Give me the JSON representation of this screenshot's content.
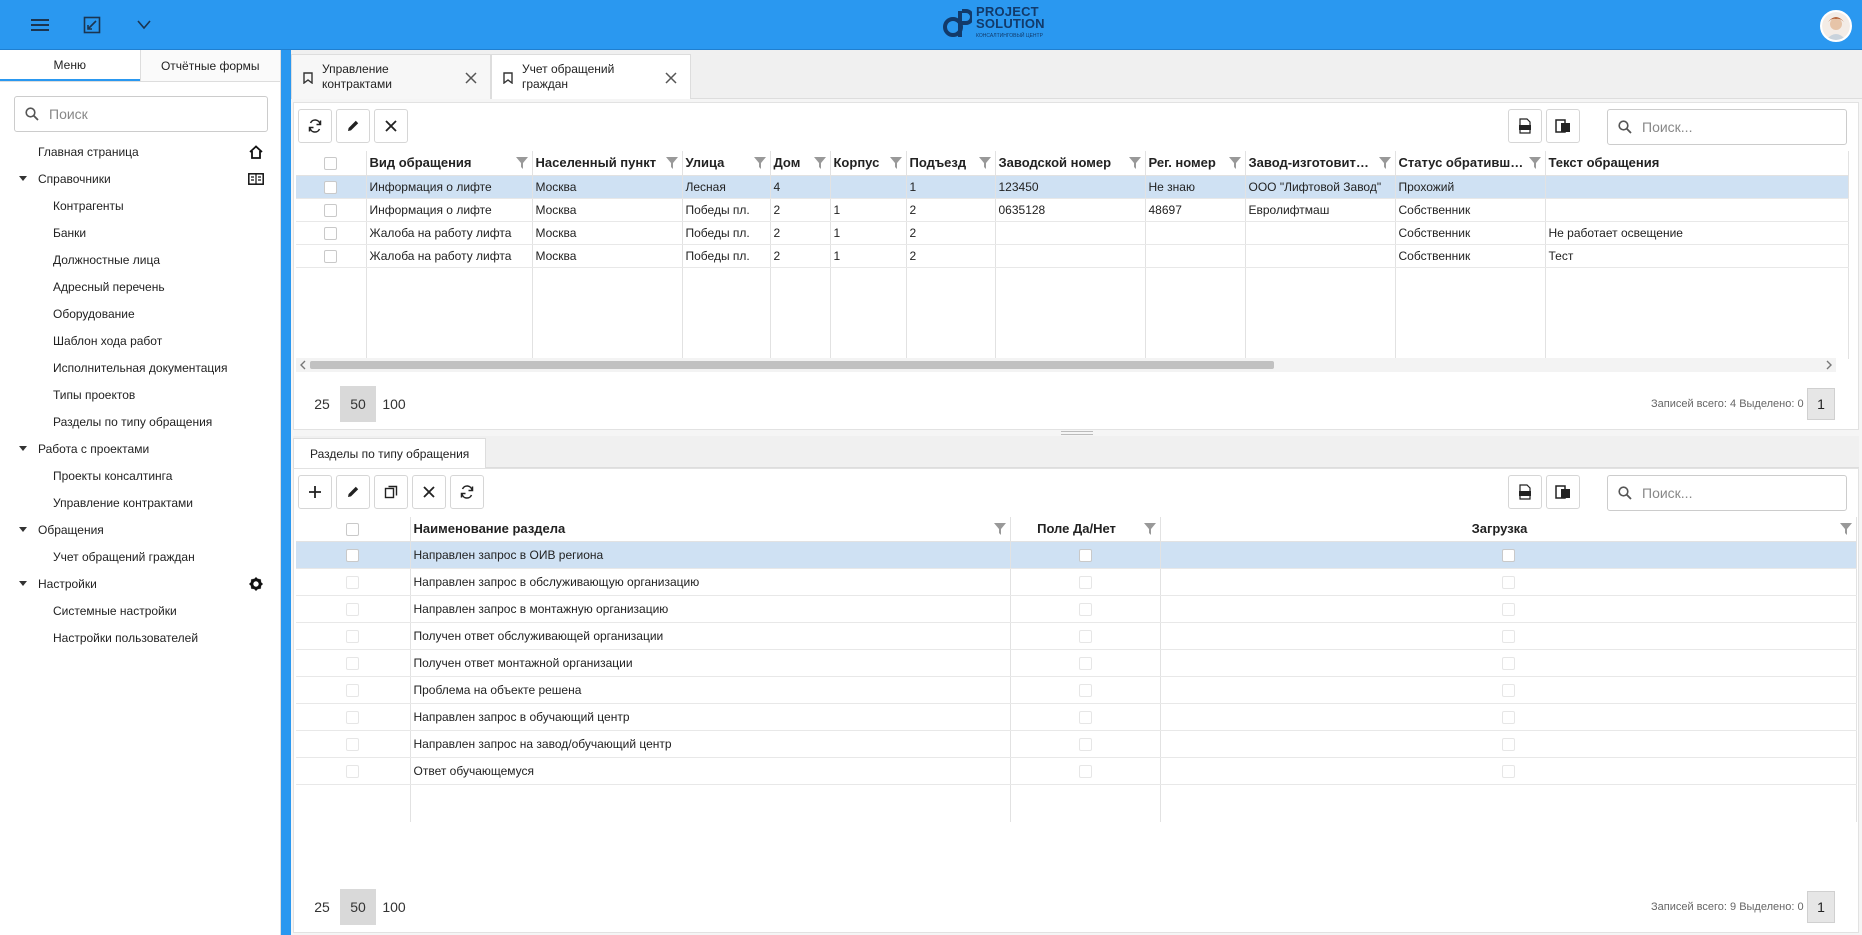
{
  "app": {
    "logo_line1": "PROJECT",
    "logo_line2": "SOLUTION",
    "logo_tagline": "КОНСАЛТИНГОВЫЙ ЦЕНТР"
  },
  "colors": {
    "accent": "#2a98f0",
    "selected_row": "#cfe1f3"
  },
  "sidebar": {
    "tabs": [
      "Меню",
      "Отчётные формы"
    ],
    "search_placeholder": "Поиск",
    "items": [
      {
        "label": "Главная страница",
        "level": 0,
        "icon": "home-icon"
      },
      {
        "label": "Справочники",
        "level": 0,
        "expanded": true,
        "icon": "book-icon"
      },
      {
        "label": "Контрагенты",
        "level": 1
      },
      {
        "label": "Банки",
        "level": 1
      },
      {
        "label": "Должностные лица",
        "level": 1
      },
      {
        "label": "Адресный перечень",
        "level": 1
      },
      {
        "label": "Оборудование",
        "level": 1
      },
      {
        "label": "Шаблон хода работ",
        "level": 1
      },
      {
        "label": "Исполнительная документация",
        "level": 1
      },
      {
        "label": "Типы проектов",
        "level": 1
      },
      {
        "label": "Разделы по типу обращения",
        "level": 1
      },
      {
        "label": "Работа с проектами",
        "level": 0,
        "expanded": true
      },
      {
        "label": "Проекты консалтинга",
        "level": 1
      },
      {
        "label": "Управление контрактами",
        "level": 1
      },
      {
        "label": "Обращения",
        "level": 0,
        "expanded": true
      },
      {
        "label": "Учет обращений граждан",
        "level": 1
      },
      {
        "label": "Настройки",
        "level": 0,
        "expanded": true,
        "icon": "gear-icon"
      },
      {
        "label": "Системные настройки",
        "level": 1
      },
      {
        "label": "Настройки пользователей",
        "level": 1
      }
    ]
  },
  "doc_tabs": [
    {
      "line1": "Управление",
      "line2": "контрактами",
      "active": false
    },
    {
      "line1": "Учет обращений",
      "line2": "граждан",
      "active": true
    }
  ],
  "top_grid": {
    "search_placeholder": "Поиск...",
    "columns": [
      "Вид обращения",
      "Населенный пункт",
      "Улица",
      "Дом",
      "Корпус",
      "Подъезд",
      "Заводской номер",
      "Рег. номер",
      "Завод-изготовитель",
      "Статус обратившегося",
      "Текст обращения"
    ],
    "rows": [
      [
        "Информация о лифте",
        "Москва",
        "Лесная",
        "4",
        "",
        "1",
        "123450",
        "Не знаю",
        "ООО \"Лифтовой Завод\"",
        "Прохожий",
        ""
      ],
      [
        "Информация о лифте",
        "Москва",
        "Победы пл.",
        "2",
        "1",
        "2",
        "0635128",
        "48697",
        "Евролифтмаш",
        "Собственник",
        ""
      ],
      [
        "Жалоба на работу лифта",
        "Москва",
        "Победы пл.",
        "2",
        "1",
        "2",
        "",
        "",
        "",
        "Собственник",
        "Не работает освещение"
      ],
      [
        "Жалоба на работу лифта",
        "Москва",
        "Победы пл.",
        "2",
        "1",
        "2",
        "",
        "",
        "",
        "Собственник",
        "Тест"
      ]
    ],
    "selected_row": 0,
    "page_sizes": [
      "25",
      "50",
      "100"
    ],
    "active_page_size": "50",
    "records_info": "Записей всего: 4 Выделено: 0",
    "page": "1"
  },
  "bottom_grid": {
    "tab_label": "Разделы по типу обращения",
    "search_placeholder": "Поиск...",
    "columns": [
      "Наименование раздела",
      "Поле Да/Нет",
      "Загрузка"
    ],
    "rows": [
      "Направлен запрос в ОИВ региона",
      "Направлен запрос в обслуживающую организацию",
      "Направлен запрос в монтажную организацию",
      "Получен ответ обслуживающей организации",
      "Получен ответ монтажной организации",
      "Проблема на объекте решена",
      "Направлен запрос в обучающий центр",
      "Направлен запрос на завод/обучающий центр",
      "Ответ обучающемуся"
    ],
    "selected_row": 0,
    "page_sizes": [
      "25",
      "50",
      "100"
    ],
    "active_page_size": "50",
    "records_info": "Записей всего: 9 Выделено: 0",
    "page": "1"
  }
}
